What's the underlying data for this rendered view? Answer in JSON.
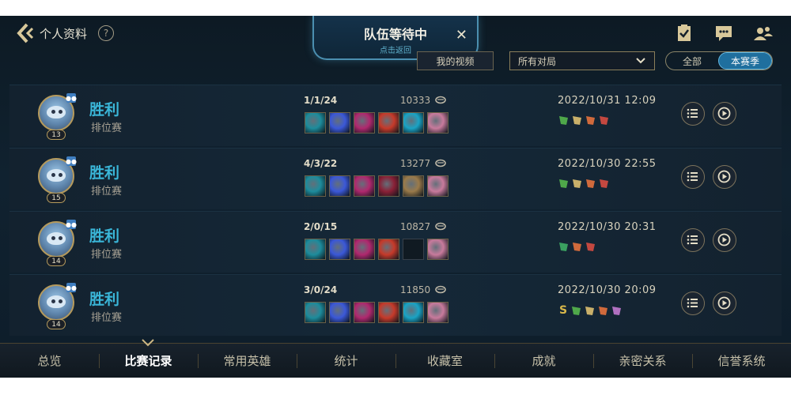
{
  "header": {
    "title": "个人资料",
    "help_label": "?",
    "team_banner": {
      "title": "队伍等待中",
      "subtitle": "点击返回",
      "close_label": "✕"
    }
  },
  "filters": {
    "my_video": "我的视频",
    "match_type": "所有对局",
    "season_options": [
      "全部",
      "本赛季"
    ],
    "season_selected": "本赛季"
  },
  "matches": [
    {
      "result": "胜利",
      "mode": "排位赛",
      "level": "13",
      "kda": "1/1/24",
      "gold": "10333",
      "datetime": "2022/10/31 12:09",
      "items": [
        "#1d8c9c",
        "#3b58d8",
        "#b0286e",
        "#c63a2a",
        "#1aa3c4",
        "#c87a9c"
      ],
      "tags": [
        "#4fa84a",
        "#c9b06a",
        "#d06a3c",
        "#c44840"
      ]
    },
    {
      "result": "胜利",
      "mode": "排位赛",
      "level": "15",
      "kda": "4/3/22",
      "gold": "13277",
      "datetime": "2022/10/30 22:55",
      "items": [
        "#1d8c9c",
        "#3b58d8",
        "#b0286e",
        "#8a2036",
        "#9a7a4a",
        "#c87a9c"
      ],
      "tags": [
        "#4fa84a",
        "#c9b06a",
        "#d06a3c",
        "#c44840"
      ]
    },
    {
      "result": "胜利",
      "mode": "排位赛",
      "level": "14",
      "kda": "2/0/15",
      "gold": "10827",
      "datetime": "2022/10/30 20:31",
      "items": [
        "#1d8c9c",
        "#3b58d8",
        "#b0286e",
        "#c63a2a",
        "",
        "#c87a9c"
      ],
      "tags": [
        "#3aa060",
        "#d06a3c",
        "#c44840"
      ]
    },
    {
      "result": "胜利",
      "mode": "排位赛",
      "level": "14",
      "kda": "3/0/24",
      "gold": "11850",
      "datetime": "2022/10/30 20:09",
      "items": [
        "#1d8c9c",
        "#3b58d8",
        "#b0286e",
        "#c63a2a",
        "#1aa3c4",
        "#c87a9c"
      ],
      "tags": [
        "S",
        "#4fa84a",
        "#c9b06a",
        "#d06a3c",
        "#b070c0"
      ]
    }
  ],
  "nav": {
    "items": [
      "总览",
      "比赛记录",
      "常用英雄",
      "统计",
      "收藏室",
      "成就",
      "亲密关系",
      "信誉系统"
    ],
    "active": "比赛记录"
  }
}
